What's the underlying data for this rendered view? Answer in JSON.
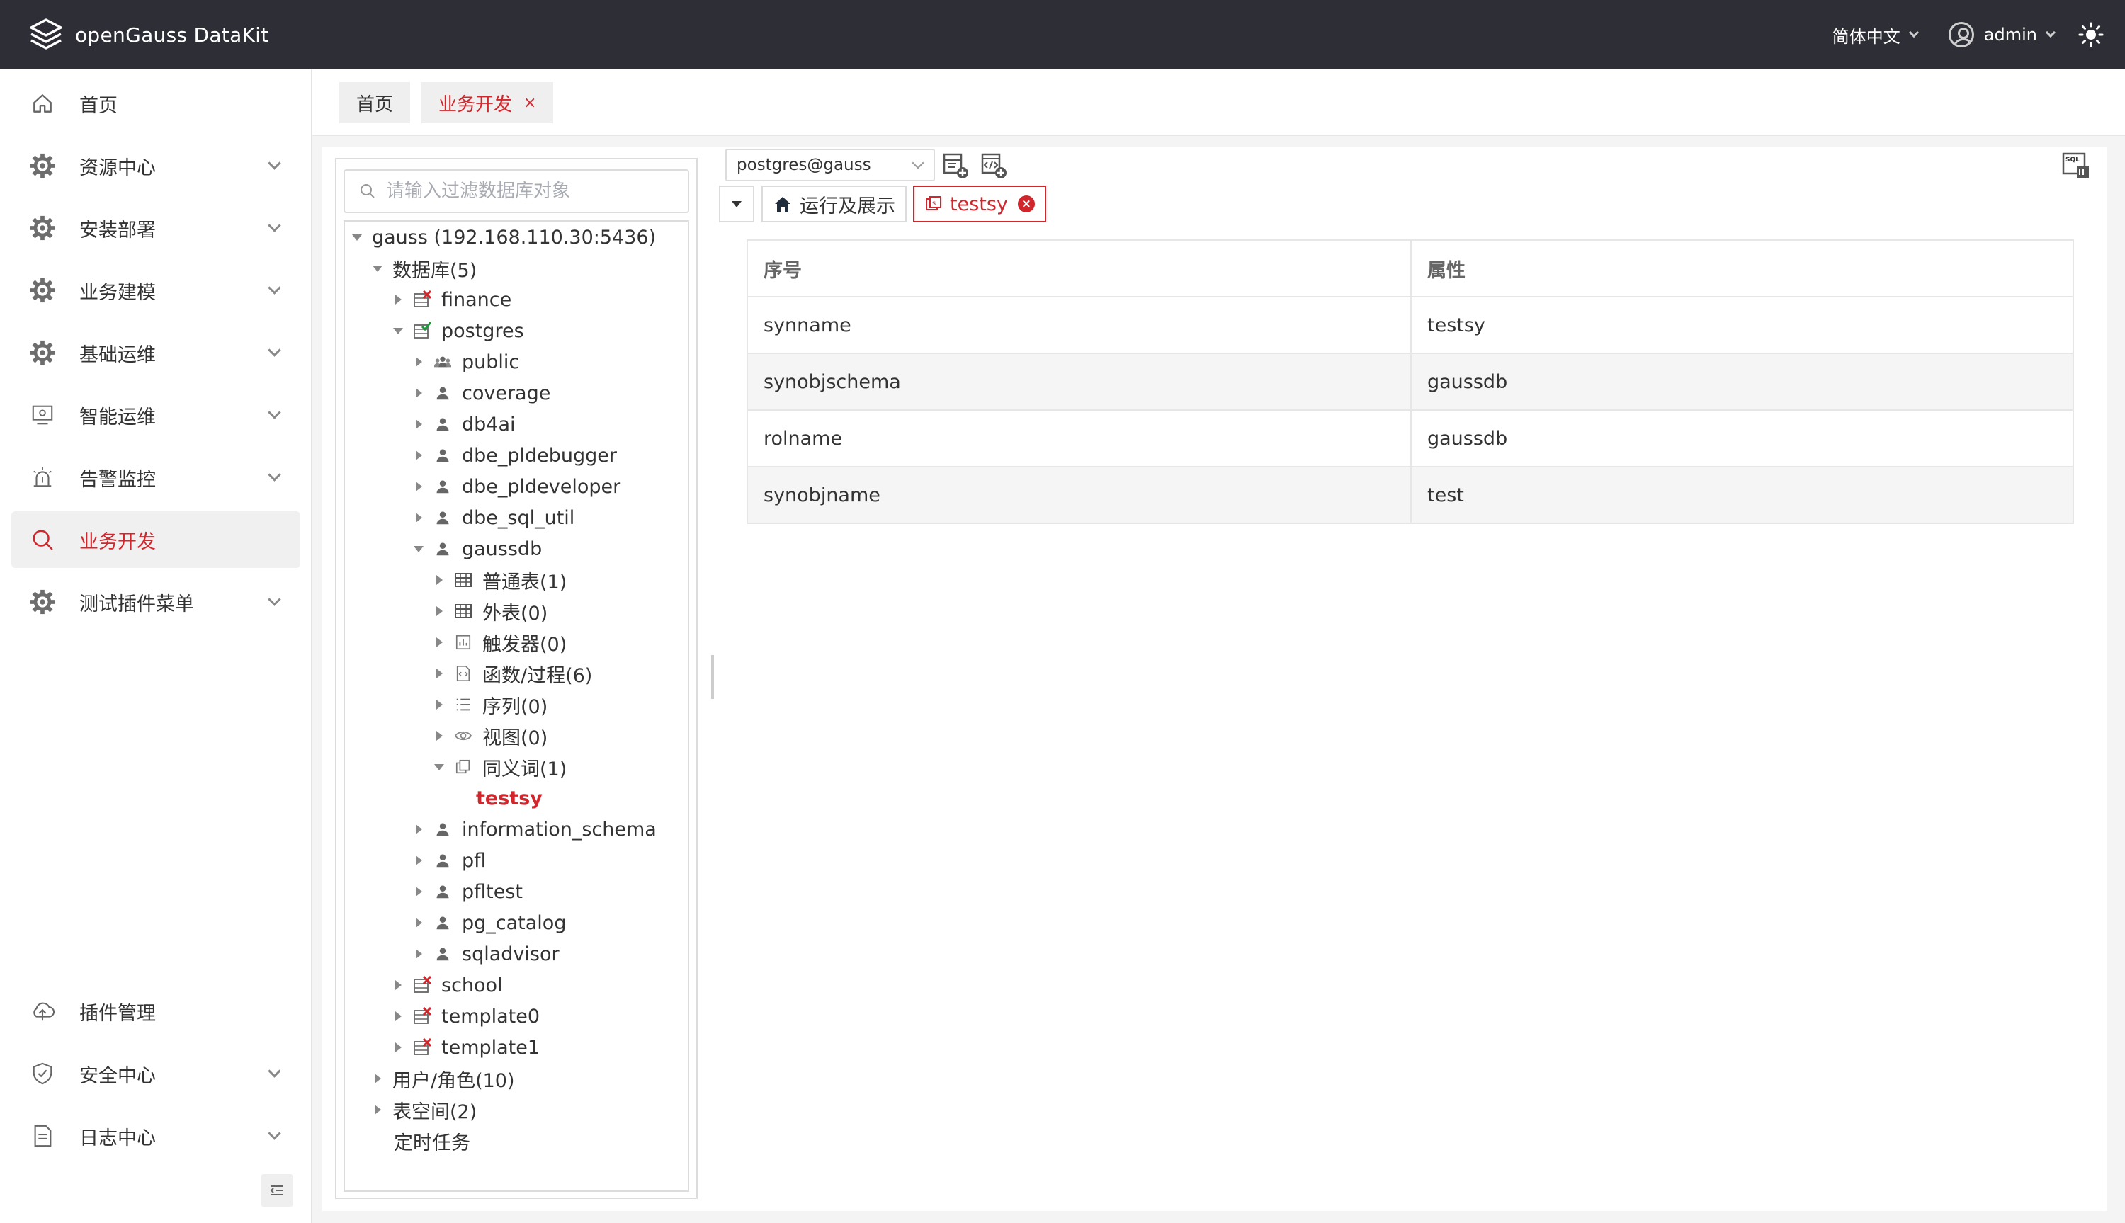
{
  "app": {
    "title": "openGauss DataKit",
    "language": "简体中文",
    "user": "admin"
  },
  "sidebar": {
    "items": [
      {
        "label": "首页",
        "icon": "home-icon",
        "expandable": false
      },
      {
        "label": "资源中心",
        "icon": "gear-icon",
        "expandable": true
      },
      {
        "label": "安装部署",
        "icon": "gear-icon",
        "expandable": true
      },
      {
        "label": "业务建模",
        "icon": "gear-icon",
        "expandable": true
      },
      {
        "label": "基础运维",
        "icon": "gear-icon",
        "expandable": true
      },
      {
        "label": "智能运维",
        "icon": "monitor-icon",
        "expandable": true
      },
      {
        "label": "告警监控",
        "icon": "alarm-icon",
        "expandable": true
      },
      {
        "label": "业务开发",
        "icon": "search-icon",
        "expandable": false,
        "active": true
      },
      {
        "label": "测试插件菜单",
        "icon": "gear-icon",
        "expandable": true
      }
    ],
    "bottom_items": [
      {
        "label": "插件管理",
        "icon": "plugin-icon",
        "expandable": false
      },
      {
        "label": "安全中心",
        "icon": "shield-icon",
        "expandable": true
      },
      {
        "label": "日志中心",
        "icon": "document-icon",
        "expandable": true
      }
    ]
  },
  "page_tabs": [
    {
      "label": "首页",
      "active": false
    },
    {
      "label": "业务开发",
      "active": true,
      "close": "×"
    }
  ],
  "tree": {
    "filter_placeholder": "请输入过滤数据库对象",
    "nodes": [
      {
        "label": "gauss (192.168.110.30:5436)",
        "level": 0,
        "state": "down",
        "icon": ""
      },
      {
        "label": "数据库(5)",
        "level": 1,
        "state": "down",
        "icon": ""
      },
      {
        "label": "finance",
        "level": 2,
        "state": "right",
        "icon": "db-disconnected-icon"
      },
      {
        "label": "postgres",
        "level": 2,
        "state": "down",
        "icon": "db-connected-icon"
      },
      {
        "label": "public",
        "level": 3,
        "state": "right",
        "icon": "users-icon"
      },
      {
        "label": "coverage",
        "level": 3,
        "state": "right",
        "icon": "user-icon"
      },
      {
        "label": "db4ai",
        "level": 3,
        "state": "right",
        "icon": "user-icon"
      },
      {
        "label": "dbe_pldebugger",
        "level": 3,
        "state": "right",
        "icon": "user-icon"
      },
      {
        "label": "dbe_pldeveloper",
        "level": 3,
        "state": "right",
        "icon": "user-icon"
      },
      {
        "label": "dbe_sql_util",
        "level": 3,
        "state": "right",
        "icon": "user-icon"
      },
      {
        "label": "gaussdb",
        "level": 3,
        "state": "down",
        "icon": "user-icon"
      },
      {
        "label": "普通表(1)",
        "level": 4,
        "state": "right",
        "icon": "table-icon"
      },
      {
        "label": "外表(0)",
        "level": 4,
        "state": "right",
        "icon": "table-icon"
      },
      {
        "label": "触发器(0)",
        "level": 4,
        "state": "right",
        "icon": "trigger-icon"
      },
      {
        "label": "函数/过程(6)",
        "level": 4,
        "state": "right",
        "icon": "function-icon"
      },
      {
        "label": "序列(0)",
        "level": 4,
        "state": "right",
        "icon": "sequence-icon"
      },
      {
        "label": "视图(0)",
        "level": 4,
        "state": "right",
        "icon": "eye-icon"
      },
      {
        "label": "同义词(1)",
        "level": 4,
        "state": "down",
        "icon": "synonym-icon"
      },
      {
        "label": "testsy",
        "level": 5,
        "state": "none",
        "icon": "",
        "selected": true
      },
      {
        "label": "information_schema",
        "level": 3,
        "state": "right",
        "icon": "user-icon"
      },
      {
        "label": "pfl",
        "level": 3,
        "state": "right",
        "icon": "user-icon"
      },
      {
        "label": "pfltest",
        "level": 3,
        "state": "right",
        "icon": "user-icon"
      },
      {
        "label": "pg_catalog",
        "level": 3,
        "state": "right",
        "icon": "user-icon"
      },
      {
        "label": "sqladvisor",
        "level": 3,
        "state": "right",
        "icon": "user-icon"
      },
      {
        "label": "school",
        "level": 2,
        "state": "right",
        "icon": "db-disconnected-icon"
      },
      {
        "label": "template0",
        "level": 2,
        "state": "right",
        "icon": "db-disconnected-icon"
      },
      {
        "label": "template1",
        "level": 2,
        "state": "right",
        "icon": "db-disconnected-icon"
      },
      {
        "label": "用户/角色(10)",
        "level": 1,
        "state": "right",
        "icon": ""
      },
      {
        "label": "表空间(2)",
        "level": 1,
        "state": "right",
        "icon": ""
      },
      {
        "label": "定时任务",
        "level": 1,
        "state": "none",
        "icon": ""
      }
    ]
  },
  "editor": {
    "connection": "postgres@gauss",
    "tabs": [
      {
        "label": "运行及展示",
        "icon": "home-icon",
        "active": false
      },
      {
        "label": "testsy",
        "icon": "synonym-icon",
        "active": true,
        "close": "×"
      }
    ]
  },
  "properties": {
    "headers": [
      "序号",
      "属性"
    ],
    "rows": [
      [
        "synname",
        "testsy"
      ],
      [
        "synobjschema",
        "gaussdb"
      ],
      [
        "rolname",
        "gaussdb"
      ],
      [
        "synobjname",
        "test"
      ]
    ]
  },
  "colors": {
    "accent": "#d0262c",
    "topbar": "#2e2e36",
    "sidebar_active_bg": "#f0f0f0"
  }
}
